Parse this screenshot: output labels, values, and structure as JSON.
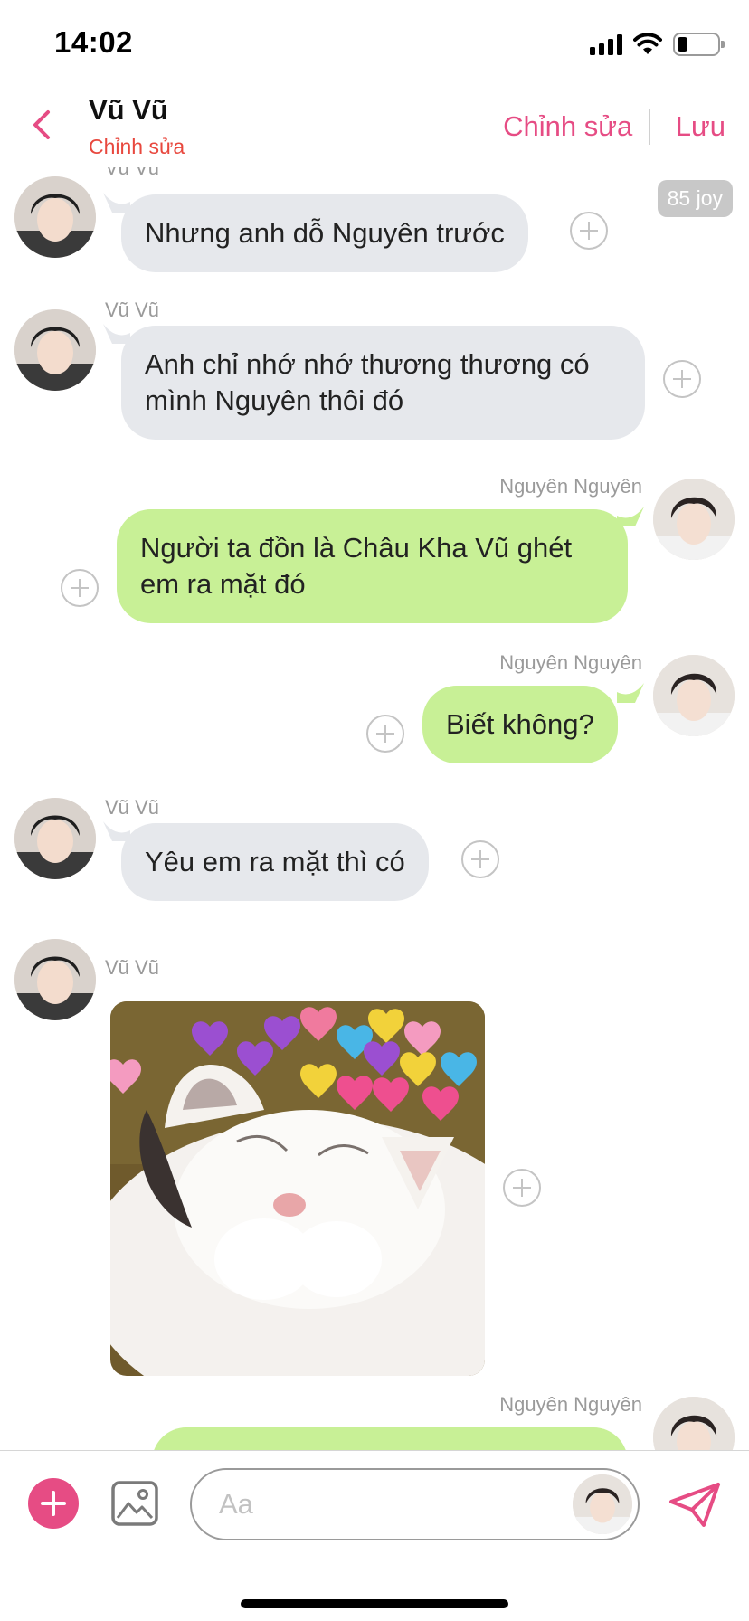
{
  "status": {
    "time": "14:02"
  },
  "header": {
    "name": "Vũ Vũ",
    "subtitle": "Chỉnh sửa",
    "edit_label": "Chỉnh sửa",
    "save_label": "Lưu"
  },
  "badge": {
    "joy": "85 joy"
  },
  "messages": [
    {
      "sender": "Vũ Vũ",
      "text": "Nhưng anh dỗ Nguyên trước"
    },
    {
      "sender": "Vũ Vũ",
      "text": "Anh chỉ nhớ nhớ thương thương có mình Nguyên thôi đó"
    },
    {
      "sender": "Nguyên Nguyên",
      "text": "Người ta đồn là Châu Kha Vũ ghét em ra mặt đó"
    },
    {
      "sender": "Nguyên Nguyên",
      "text": "Biết không?"
    },
    {
      "sender": "Vũ Vũ",
      "text": "Yêu em ra mặt thì có"
    },
    {
      "sender": "Vũ Vũ",
      "text": ""
    },
    {
      "sender": "Nguyên Nguyên",
      "text": ""
    }
  ],
  "composer": {
    "placeholder": "Aa"
  },
  "colors": {
    "accent": "#e64c84",
    "subtitle_red": "#e8483e",
    "incoming_bubble": "#e6e8ec",
    "outgoing_bubble": "#c8f096"
  },
  "icons": {
    "back": "chevron-left-icon",
    "add": "plus-circle-icon",
    "image": "image-icon",
    "send": "send-icon"
  }
}
